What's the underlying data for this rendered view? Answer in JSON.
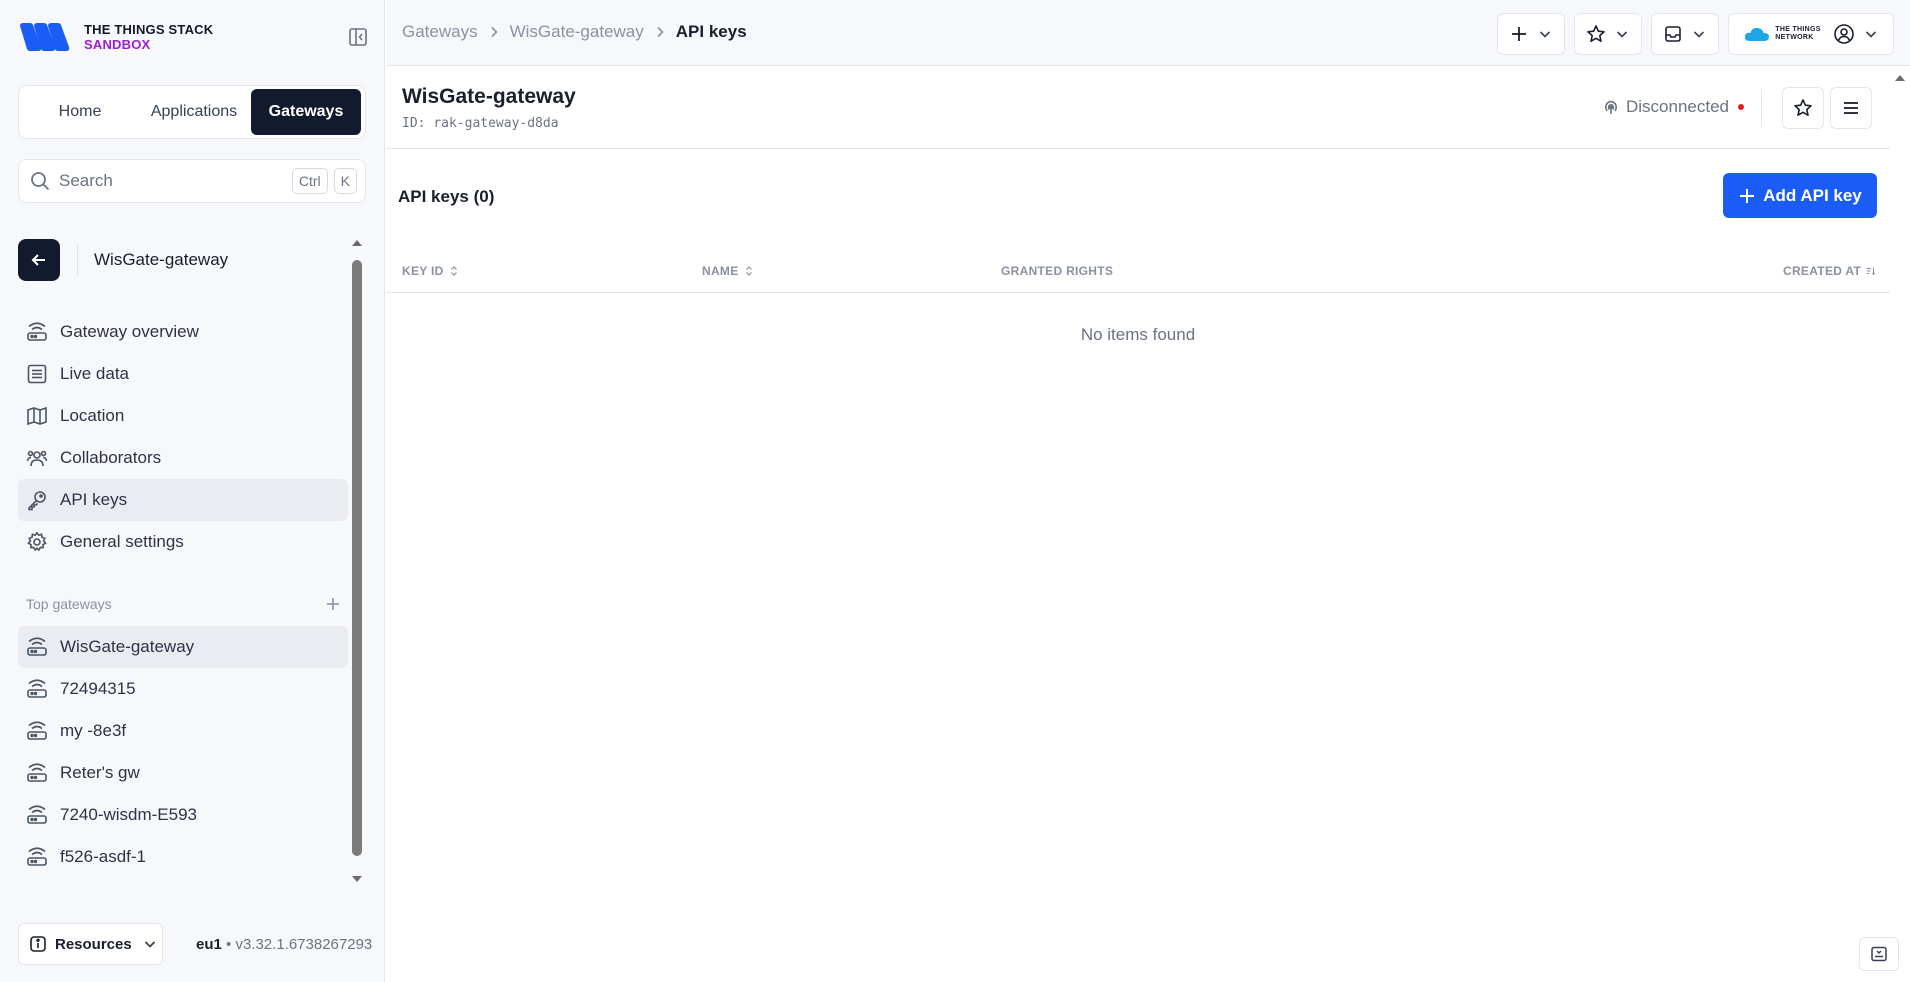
{
  "brand": {
    "line1": "THE THINGS STACK",
    "line2": "SANDBOX",
    "accent": "#a11ccf",
    "logo_color": "#1a5cf5"
  },
  "sidebar": {
    "tabs": [
      {
        "label": "Home",
        "active": false
      },
      {
        "label": "Applications",
        "active": false
      },
      {
        "label": "Gateways",
        "active": true
      }
    ],
    "search": {
      "placeholder": "Search",
      "shortcut": [
        "Ctrl",
        "K"
      ]
    },
    "entity_name": "WisGate-gateway",
    "menu": [
      {
        "label": "Gateway overview",
        "icon": "gateway-icon",
        "active": false
      },
      {
        "label": "Live data",
        "icon": "list-icon",
        "active": false
      },
      {
        "label": "Location",
        "icon": "map-icon",
        "active": false
      },
      {
        "label": "Collaborators",
        "icon": "users-icon",
        "active": false
      },
      {
        "label": "API keys",
        "icon": "key-icon",
        "active": true
      },
      {
        "label": "General settings",
        "icon": "gear-icon",
        "active": false
      }
    ],
    "top_gateways_label": "Top gateways",
    "top_gateways": [
      {
        "label": "WisGate-gateway",
        "active": true
      },
      {
        "label": "72494315",
        "active": false
      },
      {
        "label": "my -8e3f",
        "active": false
      },
      {
        "label": "Reter's gw",
        "active": false
      },
      {
        "label": "7240-wisdm-E593",
        "active": false
      },
      {
        "label": "f526-asdf-1",
        "active": false
      }
    ],
    "resources_label": "Resources",
    "cluster": "eu1",
    "version": "v3.32.1.6738267293"
  },
  "header": {
    "breadcrumb": [
      "Gateways",
      "WisGate-gateway",
      "API keys"
    ],
    "network_logo_text": [
      "THE THINGS",
      "NETWORK"
    ]
  },
  "page": {
    "title": "WisGate-gateway",
    "id_label": "ID:",
    "id_value": "rak-gateway-d8da",
    "status": "Disconnected",
    "status_color": "#e02020"
  },
  "table": {
    "title": "API keys (0)",
    "add_button": "Add API key",
    "columns": [
      "KEY ID",
      "NAME",
      "GRANTED RIGHTS",
      "CREATED AT"
    ],
    "empty_text": "No items found"
  }
}
